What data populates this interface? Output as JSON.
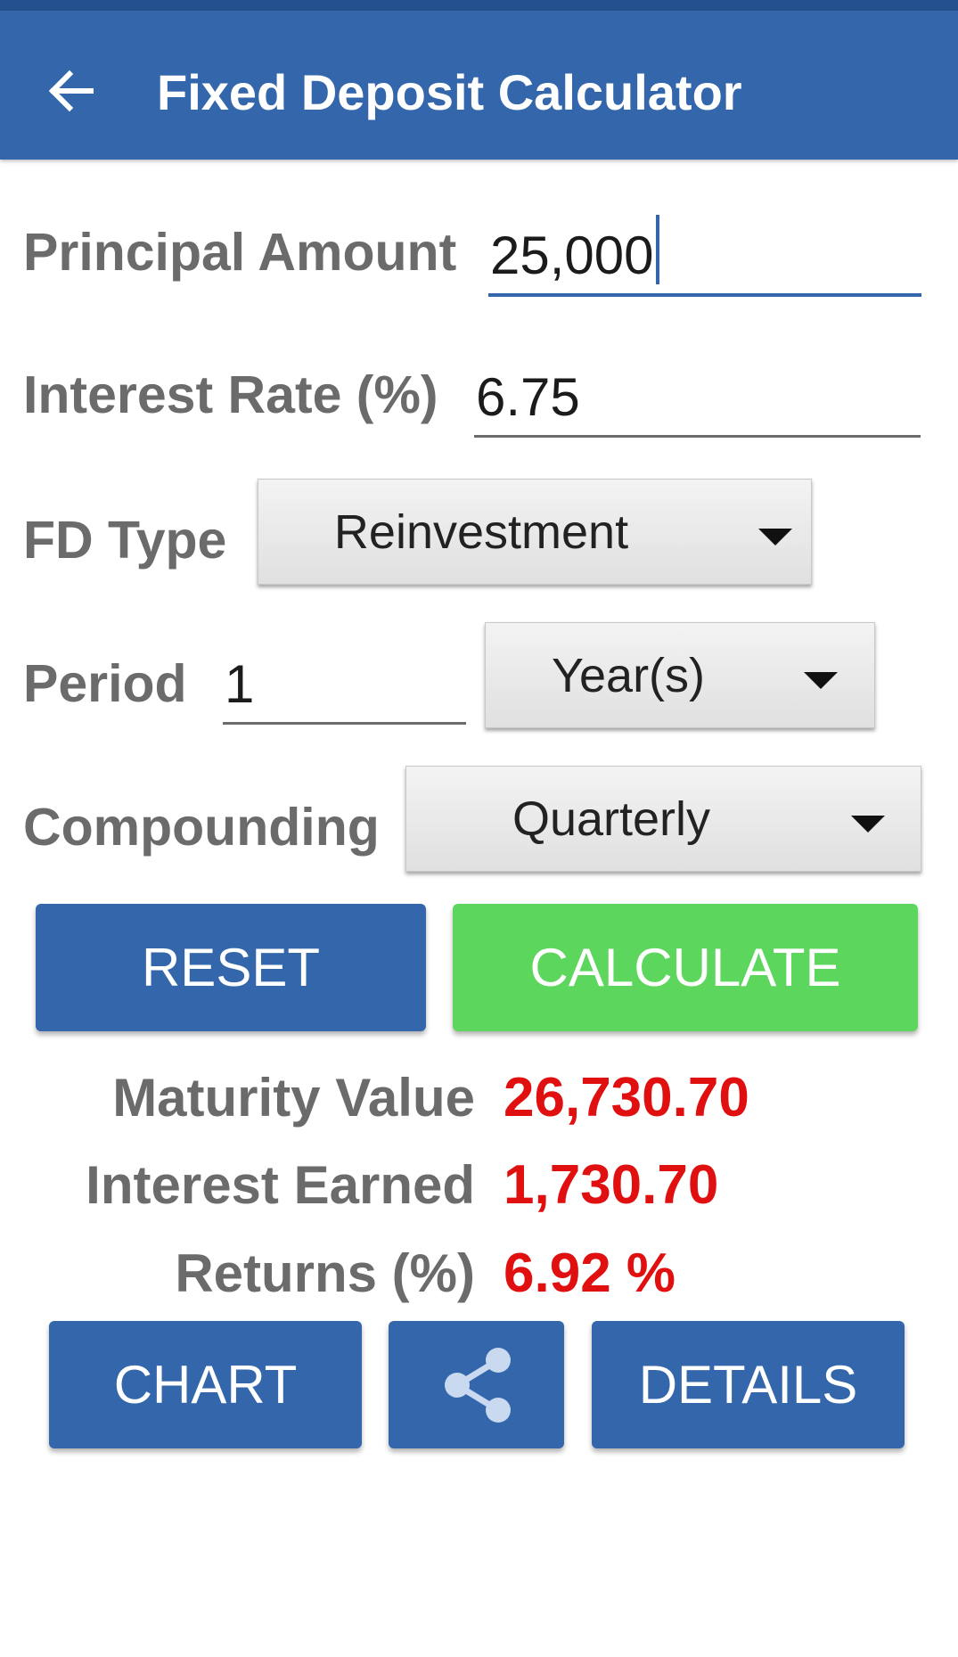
{
  "app": {
    "title": "Fixed Deposit Calculator"
  },
  "form": {
    "principal": {
      "label": "Principal Amount",
      "value": "25,000"
    },
    "interest_rate": {
      "label": "Interest Rate (%)",
      "value": "6.75"
    },
    "fd_type": {
      "label": "FD Type",
      "selected": "Reinvestment"
    },
    "period": {
      "label": "Period",
      "value": "1",
      "unit_selected": "Year(s)"
    },
    "compounding": {
      "label": "Compounding",
      "selected": "Quarterly"
    }
  },
  "actions": {
    "reset_label": "RESET",
    "calculate_label": "CALCULATE"
  },
  "results": {
    "maturity_label": "Maturity Value",
    "maturity_value": "26,730.70",
    "interest_label": "Interest Earned",
    "interest_value": "1,730.70",
    "returns_label": "Returns (%)",
    "returns_value": "6.92 %"
  },
  "bottom_actions": {
    "chart_label": "CHART",
    "share_icon": "share-icon",
    "details_label": "DETAILS"
  },
  "colors": {
    "primary": "#3366aa",
    "accent_green": "#5cd65c",
    "result_red": "#e11010",
    "label_gray": "#6b6b6b"
  }
}
